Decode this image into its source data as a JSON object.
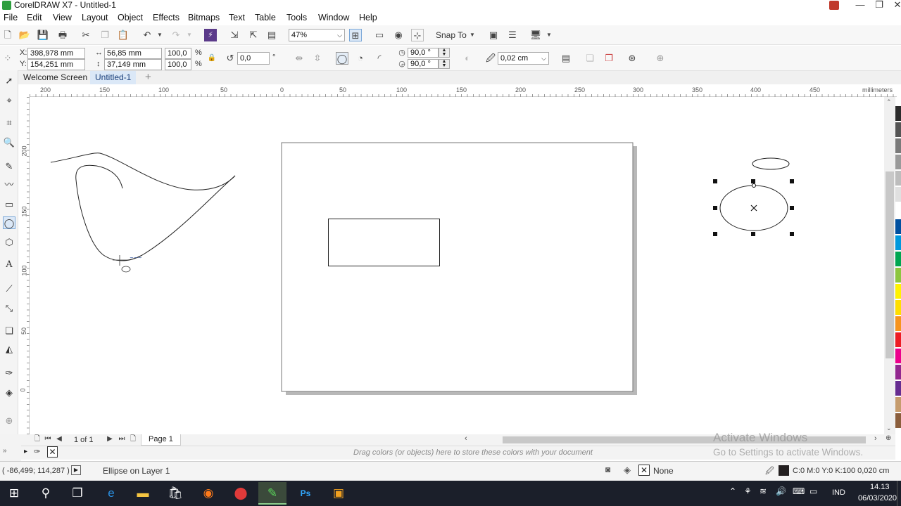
{
  "window": {
    "title": "CorelDRAW X7 - Untitled-1"
  },
  "menu": [
    "File",
    "Edit",
    "View",
    "Layout",
    "Object",
    "Effects",
    "Bitmaps",
    "Text",
    "Table",
    "Tools",
    "Window",
    "Help"
  ],
  "standard_toolbar": {
    "zoom": "47%",
    "snap_to": "Snap To"
  },
  "property_bar": {
    "x": "398,978 mm",
    "y": "154,251 mm",
    "width": "56,85 mm",
    "height": "37,149 mm",
    "scale_x": "100,0",
    "scale_y": "100,0",
    "percent": "%",
    "rotation": "0,0",
    "degree": "°",
    "arc_start": "90,0 °",
    "arc_end": "90,0 °",
    "outline_width": "0,02 cm",
    "x_label": "X:",
    "y_label": "Y:"
  },
  "tabs": [
    "Welcome Screen",
    "Untitled-1"
  ],
  "ruler": {
    "h_ticks": [
      "200",
      "150",
      "100",
      "50",
      "0",
      "50",
      "100",
      "150",
      "200",
      "250",
      "300",
      "350",
      "400",
      "450"
    ],
    "unit": "millimeters",
    "v_ticks": [
      "200",
      "150",
      "100",
      "50",
      "0"
    ]
  },
  "page_nav": {
    "counter": "1 of 1",
    "page_tab": "Page 1"
  },
  "color_well": {
    "hint": "Drag colors (or objects) here to store these colors with your document"
  },
  "watermark": {
    "line1": "Activate Windows",
    "line2": "Go to Settings to activate Windows."
  },
  "status": {
    "coords": "( -86,499; 114,287 )",
    "object": "Ellipse on Layer 1",
    "fill": "None",
    "outline": "C:0 M:0 Y:0 K:100  0,020 cm"
  },
  "taskbar": {
    "lang": "IND",
    "time": "14.13",
    "date": "06/03/2020"
  },
  "palette_colors": [
    "#2b2b2b",
    "#555555",
    "#7a7a7a",
    "#9a9a9a",
    "#bdbdbd",
    "#e0e0e0",
    "#ffffff",
    "#0050a0",
    "#0099dd",
    "#00a651",
    "#8dc63f",
    "#fff200",
    "#ffde00",
    "#f7941d",
    "#ed1c24",
    "#ec008c",
    "#92278f",
    "#662d91",
    "#c69c6d",
    "#8b5e3c"
  ],
  "accent": "#2e9e3e"
}
